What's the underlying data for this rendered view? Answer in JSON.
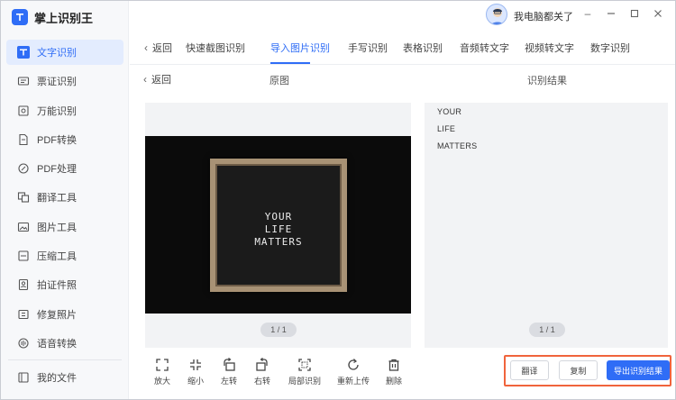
{
  "app": {
    "name": "掌上识别王"
  },
  "user": {
    "name": "我电脑都关了"
  },
  "window_controls": [
    "minimize-dash",
    "minimize",
    "maximize",
    "close"
  ],
  "sidebar": {
    "items": [
      {
        "label": "文字识别",
        "icon": "text-recognition-icon",
        "active": true
      },
      {
        "label": "票证识别",
        "icon": "ticket-icon"
      },
      {
        "label": "万能识别",
        "icon": "scan-icon"
      },
      {
        "label": "PDF转换",
        "icon": "pdf-convert-icon"
      },
      {
        "label": "PDF处理",
        "icon": "pdf-process-icon"
      },
      {
        "label": "翻译工具",
        "icon": "translate-icon"
      },
      {
        "label": "图片工具",
        "icon": "image-icon"
      },
      {
        "label": "压缩工具",
        "icon": "compress-icon"
      },
      {
        "label": "拍证件照",
        "icon": "id-photo-icon"
      },
      {
        "label": "修复照片",
        "icon": "photo-repair-icon"
      },
      {
        "label": "语音转换",
        "icon": "voice-icon"
      }
    ],
    "my_files": "我的文件"
  },
  "tabs": {
    "back": "返回",
    "items": [
      "快速截图识别",
      "导入图片识别",
      "手写识别",
      "表格识别",
      "音频转文字",
      "视频转文字",
      "数字识别"
    ],
    "active_index": 1
  },
  "subheader": {
    "back": "返回",
    "original_label": "原图",
    "result_label": "识别结果"
  },
  "image": {
    "lines": [
      "YOUR",
      "LIFE",
      "MATTERS"
    ],
    "pager": "1 / 1"
  },
  "result": {
    "lines": [
      "YOUR",
      "LIFE",
      "MATTERS"
    ],
    "pager": "1 / 1"
  },
  "toolbar": [
    {
      "label": "放大",
      "icon": "zoom-in-icon"
    },
    {
      "label": "缩小",
      "icon": "zoom-out-icon"
    },
    {
      "label": "左转",
      "icon": "rotate-left-icon"
    },
    {
      "label": "右转",
      "icon": "rotate-right-icon"
    },
    {
      "label": "局部识别",
      "icon": "crop-icon"
    },
    {
      "label": "重新上传",
      "icon": "reupload-icon"
    },
    {
      "label": "删除",
      "icon": "delete-icon"
    }
  ],
  "actions": {
    "translate": "翻译",
    "copy": "复制",
    "export": "导出识别结果"
  },
  "colors": {
    "accent": "#2f6df6",
    "highlight_border": "#f0643c"
  }
}
